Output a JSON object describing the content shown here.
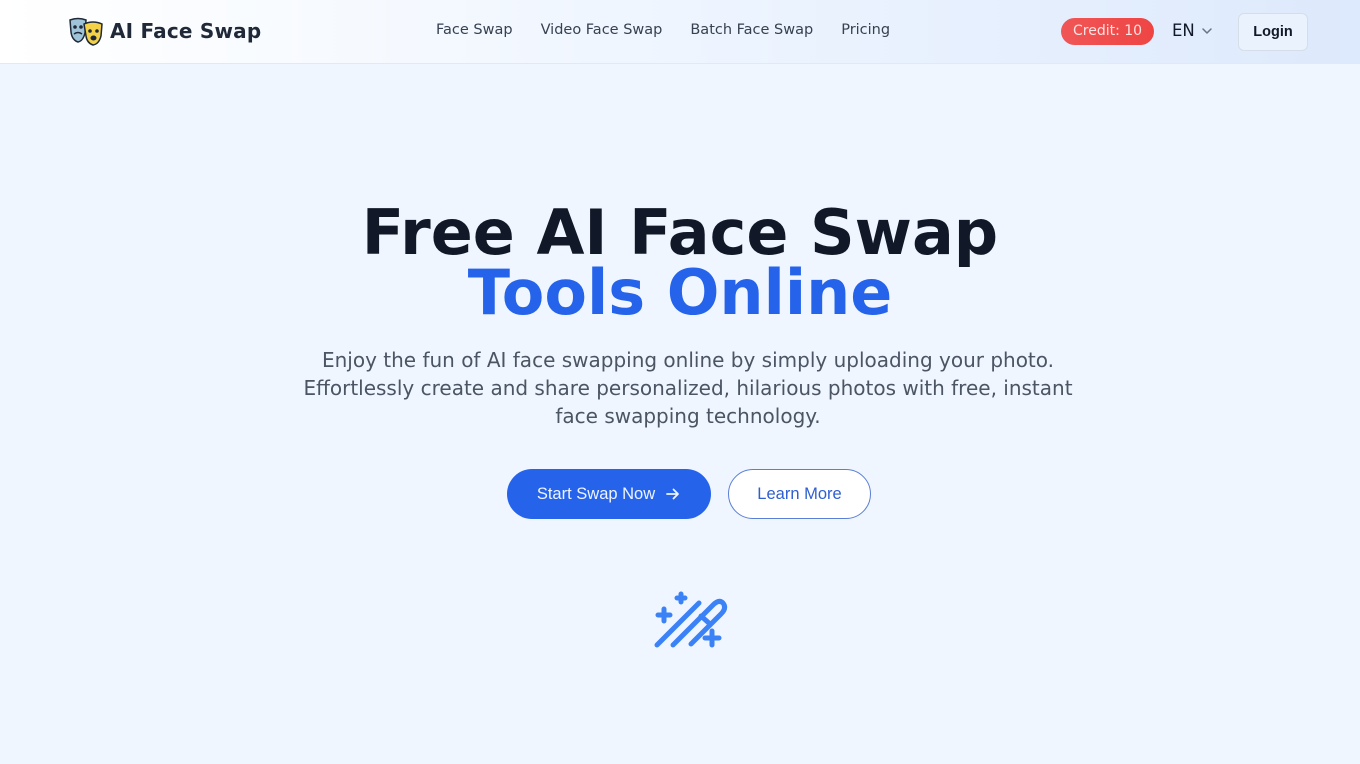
{
  "header": {
    "logo_text": "AI Face Swap",
    "nav": [
      {
        "label": "Face Swap"
      },
      {
        "label": "Video Face Swap"
      },
      {
        "label": "Batch Face Swap"
      },
      {
        "label": "Pricing"
      }
    ],
    "credit_label": "Credit: 10",
    "language": "EN",
    "login_label": "Login"
  },
  "hero": {
    "title_line1": "Free AI Face Swap",
    "title_line2": "Tools Online",
    "subtitle": "Enjoy the fun of AI face swapping online by simply uploading your photo. Effortlessly create and share personalized, hilarious photos with free, instant face swapping technology.",
    "primary_button": "Start Swap Now",
    "secondary_button": "Learn More"
  },
  "colors": {
    "accent": "#2563eb",
    "credit_badge": "#ef4444",
    "heading": "#111827"
  }
}
